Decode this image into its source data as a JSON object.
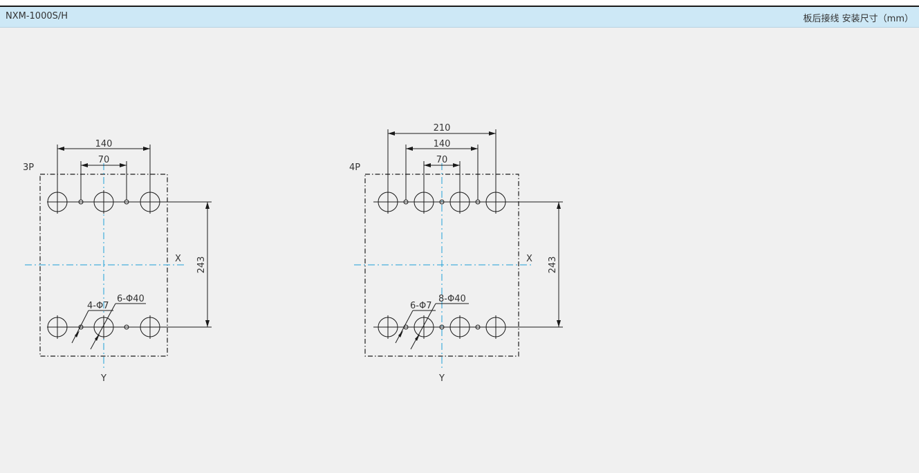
{
  "header": {
    "model": "NXM-1000S/H",
    "description": "板后接线  安装尺寸（mm）"
  },
  "colors": {
    "header_bg": "#cde8f6",
    "drawing_bg": "#f0f0f0",
    "line": "#1a1a1a",
    "centerline": "#1e9fd8"
  },
  "drawings": [
    {
      "id": "3p",
      "pole_label": "3P",
      "dim_outer": "140",
      "dim_inner": "70",
      "dim_height": "243",
      "small_holes": "4-Φ7",
      "large_holes": "6-Φ40",
      "axis_x": "X",
      "axis_y": "Y"
    },
    {
      "id": "4p",
      "pole_label": "4P",
      "dim_total": "210",
      "dim_outer": "140",
      "dim_inner": "70",
      "dim_height": "243",
      "small_holes": "6-Φ7",
      "large_holes": "8-Φ40",
      "axis_x": "X",
      "axis_y": "Y"
    }
  ]
}
